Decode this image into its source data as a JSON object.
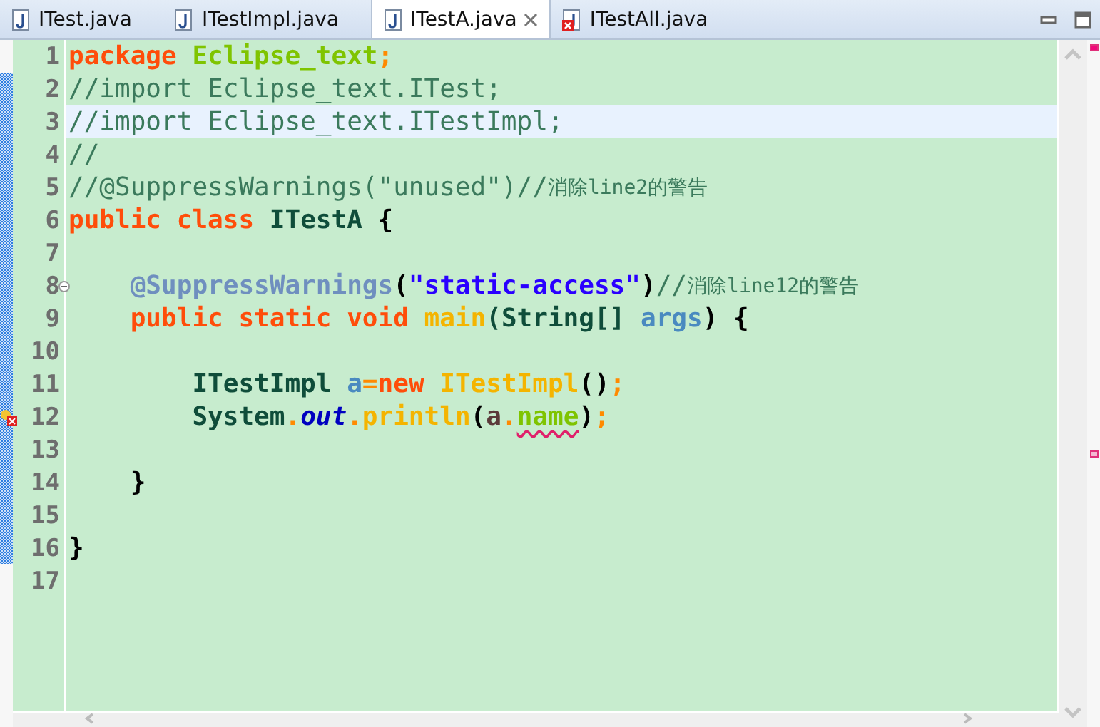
{
  "tabs": [
    {
      "label": "ITest.java",
      "selected": false,
      "error": false
    },
    {
      "label": "ITestImpl.java",
      "selected": false,
      "error": false
    },
    {
      "label": "ITestA.java",
      "selected": true,
      "error": false
    },
    {
      "label": "ITestAll.java",
      "selected": false,
      "error": true
    }
  ],
  "lines": [
    {
      "number": "1",
      "highlighted": false,
      "tokens": [
        {
          "text": "package ",
          "kind": "keyword"
        },
        {
          "text": "Eclipse_text",
          "kind": "package"
        },
        {
          "text": ";",
          "kind": "punct"
        }
      ]
    },
    {
      "number": "2",
      "highlighted": false,
      "tokens": [
        {
          "text": "//import Eclipse_text.ITest;",
          "kind": "comment"
        }
      ]
    },
    {
      "number": "3",
      "highlighted": true,
      "tokens": [
        {
          "text": "//import Eclipse_text.ITestImpl;",
          "kind": "comment"
        }
      ]
    },
    {
      "number": "4",
      "highlighted": false,
      "tokens": [
        {
          "text": "//",
          "kind": "comment"
        }
      ]
    },
    {
      "number": "5",
      "highlighted": false,
      "tokens": [
        {
          "text": "//@SuppressWarnings(\"unused\")//",
          "kind": "comment"
        },
        {
          "text": "消除line2的警告",
          "kind": "note"
        }
      ]
    },
    {
      "number": "6",
      "highlighted": false,
      "tokens": [
        {
          "text": "public class ",
          "kind": "keyword"
        },
        {
          "text": "ITestA ",
          "kind": "type"
        },
        {
          "text": "{",
          "kind": "brace"
        }
      ]
    },
    {
      "number": "7",
      "highlighted": false
    },
    {
      "number": "8",
      "highlighted": false,
      "foldable": true,
      "tokens": [
        {
          "text": "    @SuppressWarnings",
          "kind": "annotation"
        },
        {
          "text": "(",
          "kind": "brace"
        },
        {
          "text": "\"static-access\"",
          "kind": "string"
        },
        {
          "text": ")",
          "kind": "brace"
        },
        {
          "text": "//",
          "kind": "comment"
        },
        {
          "text": "消除line12的警告",
          "kind": "note"
        }
      ]
    },
    {
      "number": "9",
      "highlighted": false,
      "tokens": [
        {
          "text": "    public static void ",
          "kind": "keyword"
        },
        {
          "text": "main",
          "kind": "method"
        },
        {
          "text": "(String[] ",
          "kind": "type"
        },
        {
          "text": "args",
          "kind": "param"
        },
        {
          "text": ") {",
          "kind": "brace"
        }
      ]
    },
    {
      "number": "10",
      "highlighted": false
    },
    {
      "number": "11",
      "highlighted": false,
      "tokens": [
        {
          "text": "        ITestImpl ",
          "kind": "type"
        },
        {
          "text": "a",
          "kind": "param"
        },
        {
          "text": "=",
          "kind": "punct"
        },
        {
          "text": "new ",
          "kind": "keyword"
        },
        {
          "text": "ITestImpl",
          "kind": "method"
        },
        {
          "text": "()",
          "kind": "brace"
        },
        {
          "text": ";",
          "kind": "punct"
        }
      ]
    },
    {
      "number": "12",
      "highlighted": false,
      "error": true,
      "tokens": [
        {
          "text": "        System",
          "kind": "type"
        },
        {
          "text": ".",
          "kind": "punct"
        },
        {
          "text": "out",
          "kind": "field"
        },
        {
          "text": ".",
          "kind": "punct"
        },
        {
          "text": "println",
          "kind": "method"
        },
        {
          "text": "(",
          "kind": "brace"
        },
        {
          "text": "a",
          "kind": "local"
        },
        {
          "text": ".",
          "kind": "punct"
        },
        {
          "text": "name",
          "kind": "package",
          "error": true
        },
        {
          "text": ")",
          "kind": "brace"
        },
        {
          "text": ";",
          "kind": "punct"
        }
      ]
    },
    {
      "number": "13",
      "highlighted": false
    },
    {
      "number": "14",
      "highlighted": false,
      "tokens": [
        {
          "text": "    }",
          "kind": "brace"
        }
      ]
    },
    {
      "number": "15",
      "highlighted": false
    },
    {
      "number": "16",
      "highlighted": false,
      "tokens": [
        {
          "text": "}",
          "kind": "brace"
        }
      ]
    },
    {
      "number": "17",
      "highlighted": false
    }
  ]
}
